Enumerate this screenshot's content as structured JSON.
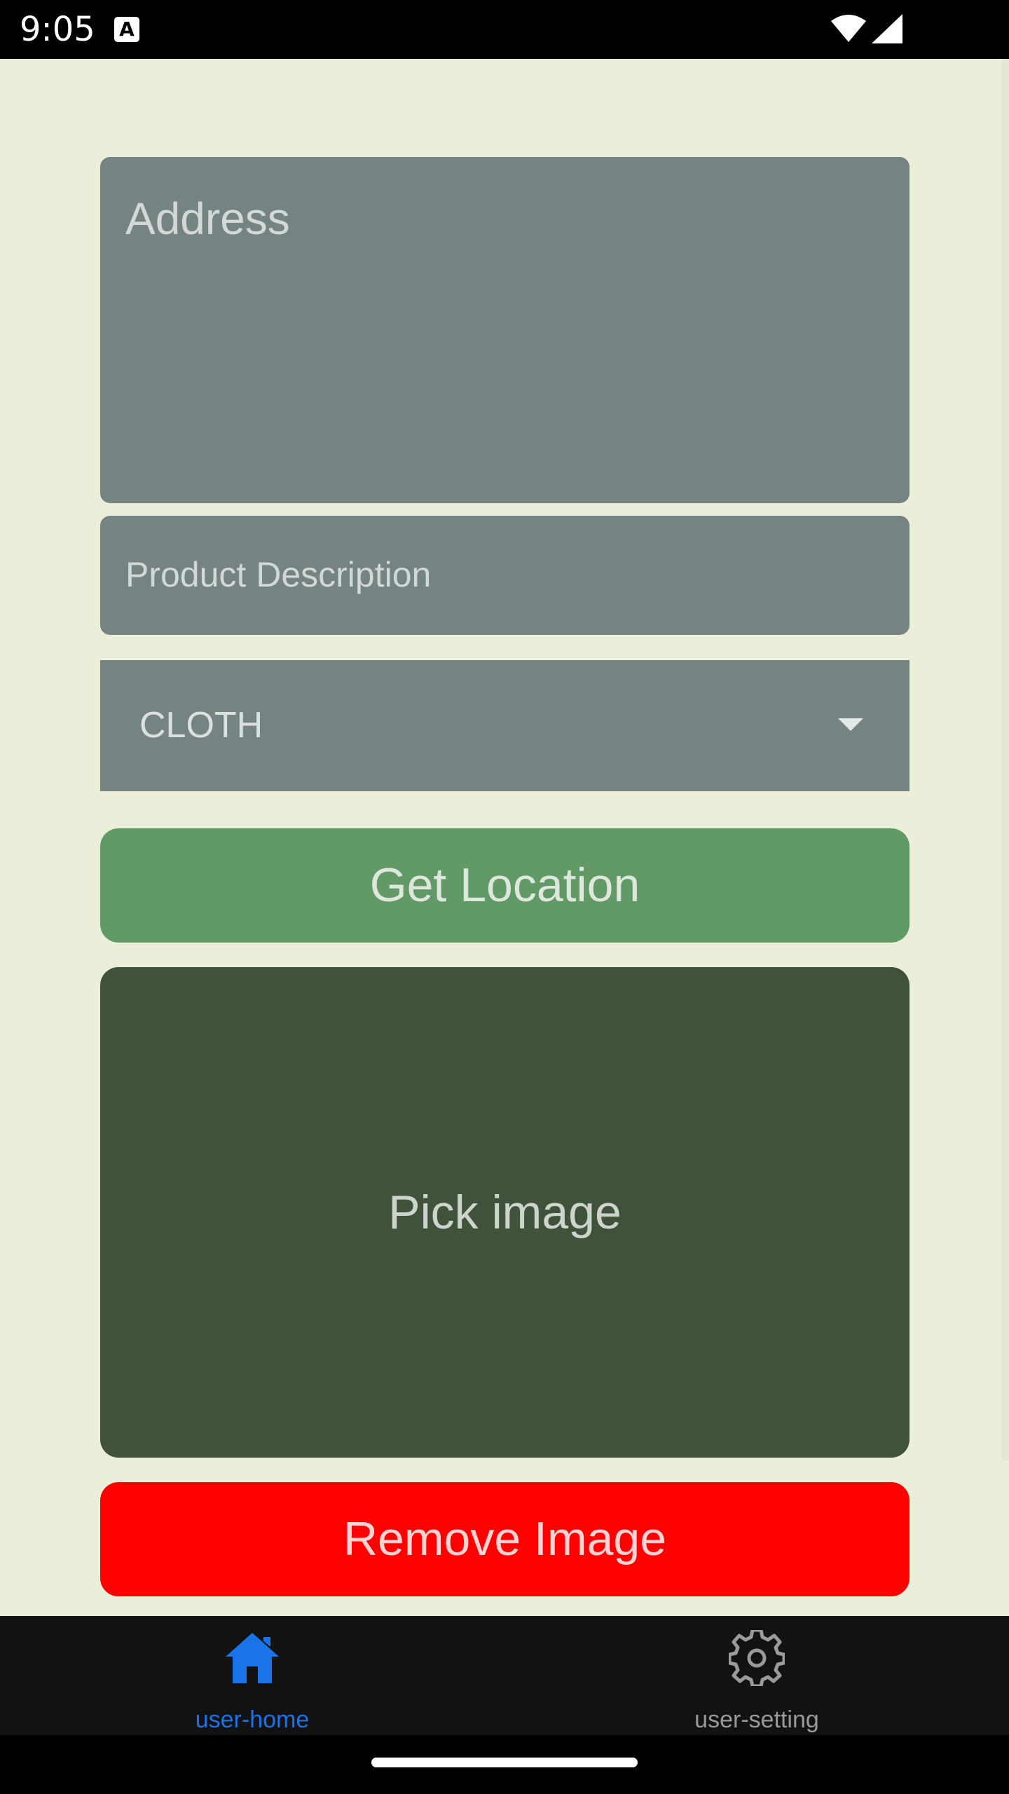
{
  "status_bar": {
    "time": "9:05",
    "app_icon_letter": "A"
  },
  "form": {
    "address_placeholder": "Address",
    "description_placeholder": "Product Description",
    "category_value": "CLOTH"
  },
  "buttons": {
    "get_location": "Get Location",
    "pick_image": "Pick image",
    "remove_image": "Remove Image"
  },
  "bottom_nav": {
    "items": [
      {
        "label": "user-home",
        "icon": "home-icon",
        "active": true
      },
      {
        "label": "user-setting",
        "icon": "gear-icon",
        "active": false
      }
    ]
  },
  "colors": {
    "background": "#ebefd9",
    "field": "#768383",
    "location_button": "#629a67",
    "pick_image_area": "#40523c",
    "remove_button": "#ff0000",
    "nav_active": "#1a73e8",
    "nav_inactive": "#9a9a9a"
  }
}
